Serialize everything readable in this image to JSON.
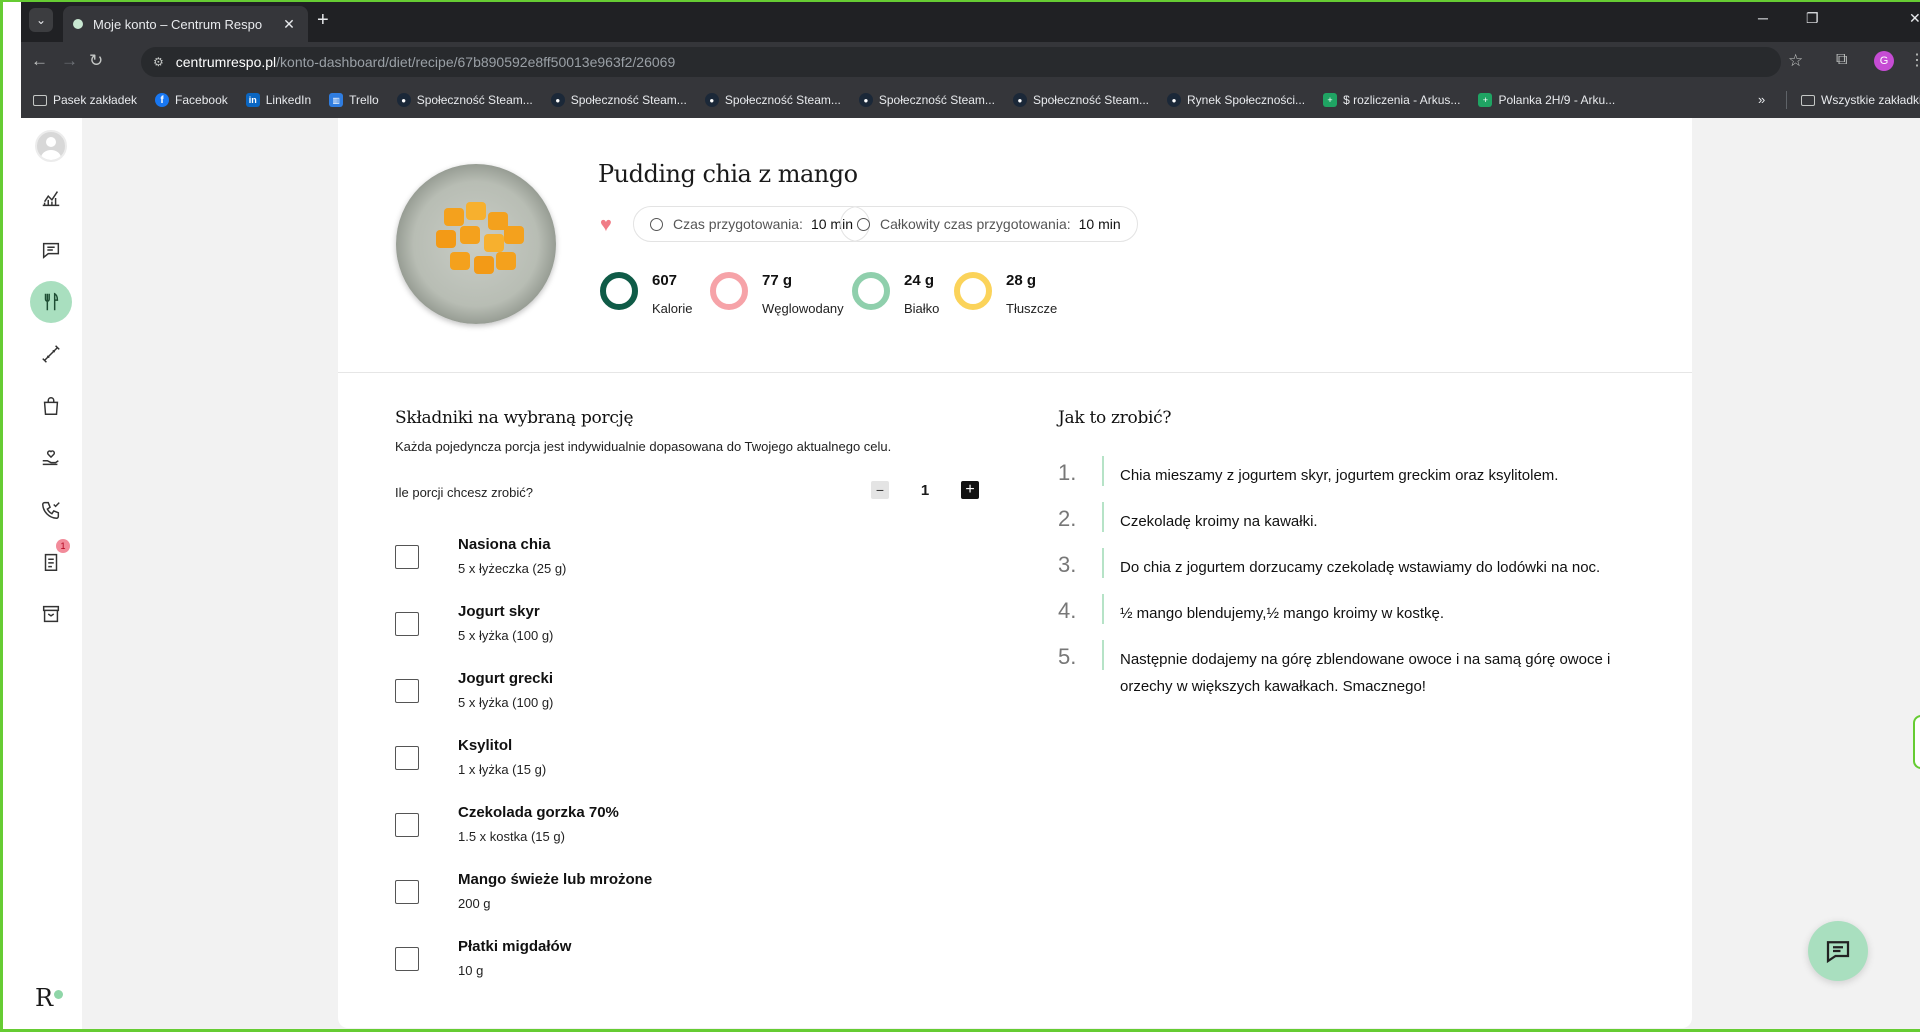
{
  "browser": {
    "tab_list_icon": "chevron-down-icon",
    "tab_title": "Moje konto – Centrum Respo",
    "tab_close": "✕",
    "new_tab": "+",
    "window_controls": [
      "─",
      "❐",
      "✕"
    ],
    "url_host": "centrumrespo.pl",
    "url_path": "/konto-dashboard/diet/recipe/67b890592e8ff50013e963f2/26069",
    "profile_initial": "G",
    "bookmarks": [
      {
        "icon": "folder",
        "label": "Pasek zakładek"
      },
      {
        "icon": "fb",
        "label": "Facebook"
      },
      {
        "icon": "li",
        "label": "LinkedIn"
      },
      {
        "icon": "trello",
        "label": "Trello"
      },
      {
        "icon": "steam",
        "label": "Społeczność Steam..."
      },
      {
        "icon": "steam",
        "label": "Społeczność Steam..."
      },
      {
        "icon": "steam",
        "label": "Społeczność Steam..."
      },
      {
        "icon": "steam",
        "label": "Społeczność Steam..."
      },
      {
        "icon": "steam",
        "label": "Społeczność Steam..."
      },
      {
        "icon": "steam",
        "label": "Rynek Społeczności..."
      },
      {
        "icon": "sheet",
        "label": "$ rozliczenia - Arkus..."
      },
      {
        "icon": "sheet",
        "label": "Polanka 2H/9 - Arku..."
      }
    ],
    "bookmarks_more": "»",
    "all_bookmarks": "Wszystkie zakładki"
  },
  "sidebar": {
    "notes_badge": "1",
    "logo_letter": "R"
  },
  "recipe": {
    "title": "Pudding chia z mango",
    "prep_time_label": "Czas przygotowania:",
    "prep_time_value": "10 min",
    "total_time_label": "Całkowity czas przygotowania:",
    "total_time_value": "10 min",
    "macros": [
      {
        "value": "607",
        "name": "Kalorie",
        "color": "#0f5b47"
      },
      {
        "value": "77 g",
        "name": "Węglowodany",
        "color": "#f6a3a8"
      },
      {
        "value": "24 g",
        "name": "Białko",
        "color": "#8fcfac"
      },
      {
        "value": "28 g",
        "name": "Tłuszcze",
        "color": "#fbd35a"
      }
    ]
  },
  "ingredients_section": {
    "title": "Składniki na wybraną porcję",
    "subtitle": "Każda pojedyncza porcja jest indywidualnie dopasowana do Twojego aktualnego celu.",
    "portions_label": "Ile porcji chcesz zrobić?",
    "portions_value": "1",
    "minus": "−",
    "plus": "+",
    "items": [
      {
        "name": "Nasiona chia",
        "amount": "5 x łyżeczka (25 g)"
      },
      {
        "name": "Jogurt skyr",
        "amount": "5 x łyżka (100 g)"
      },
      {
        "name": "Jogurt grecki",
        "amount": "5 x łyżka (100 g)"
      },
      {
        "name": "Ksylitol",
        "amount": "1 x łyżka (15 g)"
      },
      {
        "name": "Czekolada gorzka 70%",
        "amount": "1.5 x kostka (15 g)"
      },
      {
        "name": "Mango świeże lub mrożone",
        "amount": "200 g"
      },
      {
        "name": "Płatki migdałów",
        "amount": "10 g"
      }
    ]
  },
  "steps_section": {
    "title": "Jak to zrobić?",
    "steps": [
      {
        "no": "1.",
        "text": "Chia mieszamy z jogurtem skyr, jogurtem greckim oraz ksylitolem."
      },
      {
        "no": "2.",
        "text": "Czekoladę kroimy na kawałki."
      },
      {
        "no": "3.",
        "text": "Do chia z jogurtem dorzucamy czekoladę wstawiamy do lodówki na noc."
      },
      {
        "no": "4.",
        "text": "½ mango blendujemy,½ mango kroimy w kostkę."
      },
      {
        "no": "5.",
        "text": "Następnie dodajemy na górę zblendowane owoce i na samą górę owoce i orzechy w większych kawałkach. Smacznego!"
      }
    ]
  },
  "colors": {
    "accent": "#a9dfbf",
    "frame": "#66cc33"
  }
}
